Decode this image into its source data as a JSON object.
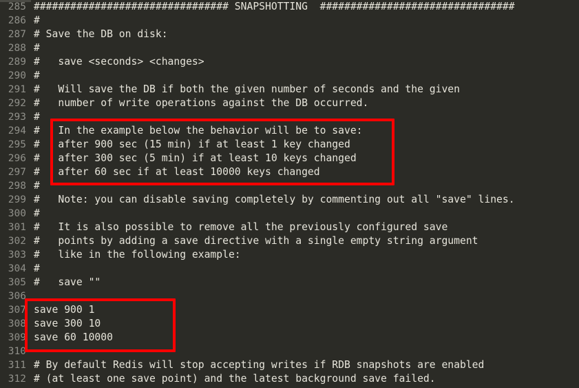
{
  "editor": {
    "background_color": "#2b2b26",
    "text_color": "#e6e4da",
    "line_number_color": "#90908a",
    "annotation_color": "#ff0000",
    "first_line_number": 285,
    "last_line_number": 312,
    "lines": [
      {
        "number": "285",
        "text": "################################ SNAPSHOTTING  ################################"
      },
      {
        "number": "286",
        "text": "#"
      },
      {
        "number": "287",
        "text": "# Save the DB on disk:"
      },
      {
        "number": "288",
        "text": "#"
      },
      {
        "number": "289",
        "text": "#   save <seconds> <changes>"
      },
      {
        "number": "290",
        "text": "#"
      },
      {
        "number": "291",
        "text": "#   Will save the DB if both the given number of seconds and the given"
      },
      {
        "number": "292",
        "text": "#   number of write operations against the DB occurred."
      },
      {
        "number": "293",
        "text": "#"
      },
      {
        "number": "294",
        "text": "#   In the example below the behavior will be to save:"
      },
      {
        "number": "295",
        "text": "#   after 900 sec (15 min) if at least 1 key changed"
      },
      {
        "number": "296",
        "text": "#   after 300 sec (5 min) if at least 10 keys changed"
      },
      {
        "number": "297",
        "text": "#   after 60 sec if at least 10000 keys changed"
      },
      {
        "number": "298",
        "text": "#"
      },
      {
        "number": "299",
        "text": "#   Note: you can disable saving completely by commenting out all \"save\" lines."
      },
      {
        "number": "300",
        "text": "#"
      },
      {
        "number": "301",
        "text": "#   It is also possible to remove all the previously configured save"
      },
      {
        "number": "302",
        "text": "#   points by adding a save directive with a single empty string argument"
      },
      {
        "number": "303",
        "text": "#   like in the following example:"
      },
      {
        "number": "304",
        "text": "#"
      },
      {
        "number": "305",
        "text": "#   save \"\""
      },
      {
        "number": "306",
        "text": ""
      },
      {
        "number": "307",
        "text": "save 900 1"
      },
      {
        "number": "308",
        "text": "save 300 10"
      },
      {
        "number": "309",
        "text": "save 60 10000"
      },
      {
        "number": "310",
        "text": ""
      },
      {
        "number": "311",
        "text": "# By default Redis will stop accepting writes if RDB snapshots are enabled"
      },
      {
        "number": "312",
        "text": "# (at least one save point) and the latest background save failed."
      }
    ],
    "annotations": [
      {
        "id": "box-example",
        "label": "example-save-policy-highlight",
        "covers_lines": [
          "294",
          "295",
          "296",
          "297"
        ]
      },
      {
        "id": "box-save",
        "label": "save-directives-highlight",
        "covers_lines": [
          "307",
          "308",
          "309"
        ]
      }
    ]
  }
}
